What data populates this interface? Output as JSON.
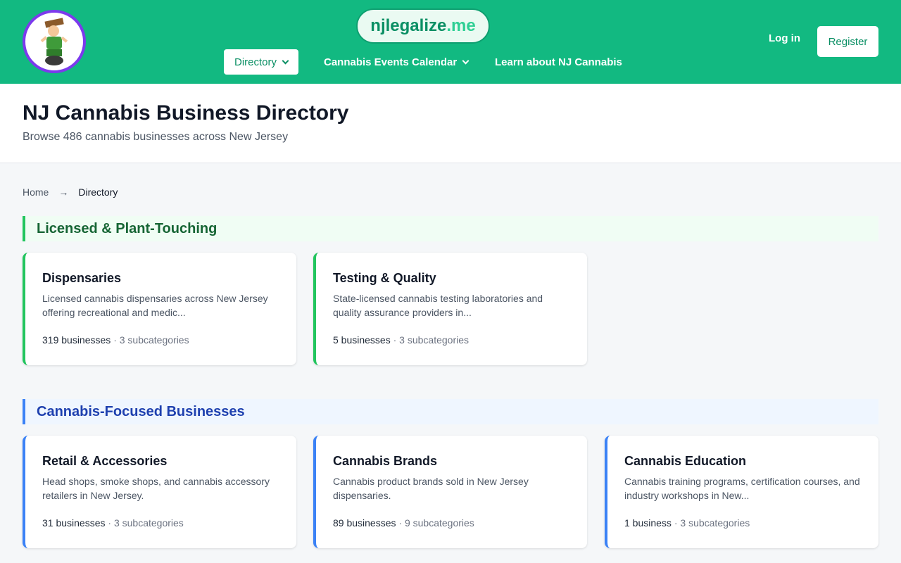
{
  "header": {
    "brand_main": "njlegalize",
    "brand_tld": ".me",
    "nav": {
      "directory": "Directory",
      "events": "Cannabis Events Calendar",
      "learn": "Learn about NJ Cannabis"
    },
    "login": "Log in",
    "register": "Register",
    "colors": {
      "header_bg": "#12b981",
      "logo_ring": "#7c3aed"
    }
  },
  "page": {
    "title": "NJ Cannabis Business Directory",
    "subtitle": "Browse 486 cannabis businesses across New Jersey"
  },
  "breadcrumb": {
    "home": "Home",
    "separator": "→",
    "current": "Directory"
  },
  "sections": [
    {
      "title": "Licensed & Plant-Touching",
      "accent": "#22c55e",
      "cards": [
        {
          "title": "Dispensaries",
          "description": "Licensed cannabis dispensaries across New Jersey offering recreational and medic...",
          "count": "319 businesses",
          "subcategories": "3 subcategories"
        },
        {
          "title": "Testing & Quality",
          "description": "State-licensed cannabis testing laboratories and quality assurance providers in...",
          "count": "5 businesses",
          "subcategories": "3 subcategories"
        }
      ]
    },
    {
      "title": "Cannabis-Focused Businesses",
      "accent": "#3b82f6",
      "cards": [
        {
          "title": "Retail & Accessories",
          "description": "Head shops, smoke shops, and cannabis accessory retailers in New Jersey.",
          "count": "31 businesses",
          "subcategories": "3 subcategories"
        },
        {
          "title": "Cannabis Brands",
          "description": "Cannabis product brands sold in New Jersey dispensaries.",
          "count": "89 businesses",
          "subcategories": "9 subcategories"
        },
        {
          "title": "Cannabis Education",
          "description": "Cannabis training programs, certification courses, and industry workshops in New...",
          "count": "1 business",
          "subcategories": "3 subcategories"
        }
      ]
    }
  ],
  "meta_separator": "·"
}
